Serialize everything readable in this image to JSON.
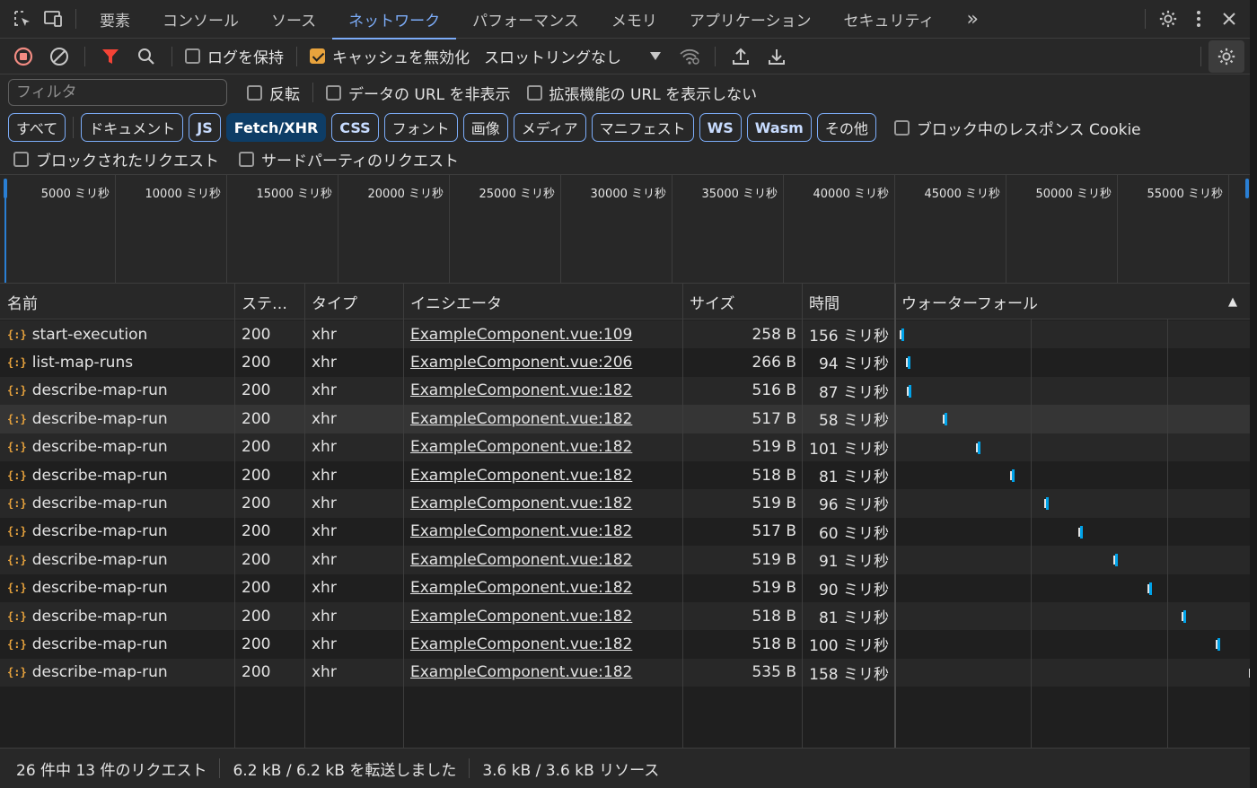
{
  "tabs": {
    "items": [
      "要素",
      "コンソール",
      "ソース",
      "ネットワーク",
      "パフォーマンス",
      "メモリ",
      "アプリケーション",
      "セキュリティ"
    ],
    "active": "ネットワーク",
    "more": "»"
  },
  "toolbar": {
    "preserve_log": "ログを保持",
    "disable_cache": "キャッシュを無効化",
    "throttling": "スロットリングなし"
  },
  "filter": {
    "placeholder": "フィルタ",
    "invert": "反転",
    "hide_data_urls": "データの URL を非表示",
    "hide_extension_urls": "拡張機能の URL を表示しない"
  },
  "type_filters": {
    "all": "すべて",
    "document": "ドキュメント",
    "js": "JS",
    "fetch_xhr": "Fetch/XHR",
    "css": "CSS",
    "font": "フォント",
    "image": "画像",
    "media": "メディア",
    "manifest": "マニフェスト",
    "ws": "WS",
    "wasm": "Wasm",
    "other": "その他",
    "blocked_cookies": "ブロック中のレスポンス Cookie"
  },
  "blocked": {
    "blocked_requests": "ブロックされたリクエスト",
    "third_party": "サードパーティのリクエスト"
  },
  "overview": {
    "labels": [
      "5000 ミリ秒",
      "10000 ミリ秒",
      "15000 ミリ秒",
      "20000 ミリ秒",
      "25000 ミリ秒",
      "30000 ミリ秒",
      "35000 ミリ秒",
      "40000 ミリ秒",
      "45000 ミリ秒",
      "50000 ミリ秒",
      "55000 ミリ秒"
    ]
  },
  "columns": {
    "name": "名前",
    "status": "ステ…",
    "type": "タイプ",
    "initiator": "イニシエータ",
    "size": "サイズ",
    "time": "時間",
    "waterfall": "ウォーターフォール",
    "sort_icon": "▲"
  },
  "rows": [
    {
      "name": "start-execution",
      "status": "200",
      "type": "xhr",
      "initiator": "ExampleComponent.vue:109",
      "size": "258 B",
      "time": "156 ミリ秒"
    },
    {
      "name": "list-map-runs",
      "status": "200",
      "type": "xhr",
      "initiator": "ExampleComponent.vue:206",
      "size": "266 B",
      "time": "94 ミリ秒"
    },
    {
      "name": "describe-map-run",
      "status": "200",
      "type": "xhr",
      "initiator": "ExampleComponent.vue:182",
      "size": "516 B",
      "time": "87 ミリ秒"
    },
    {
      "name": "describe-map-run",
      "status": "200",
      "type": "xhr",
      "initiator": "ExampleComponent.vue:182",
      "size": "517 B",
      "time": "58 ミリ秒"
    },
    {
      "name": "describe-map-run",
      "status": "200",
      "type": "xhr",
      "initiator": "ExampleComponent.vue:182",
      "size": "519 B",
      "time": "101 ミリ秒"
    },
    {
      "name": "describe-map-run",
      "status": "200",
      "type": "xhr",
      "initiator": "ExampleComponent.vue:182",
      "size": "518 B",
      "time": "81 ミリ秒"
    },
    {
      "name": "describe-map-run",
      "status": "200",
      "type": "xhr",
      "initiator": "ExampleComponent.vue:182",
      "size": "519 B",
      "time": "96 ミリ秒"
    },
    {
      "name": "describe-map-run",
      "status": "200",
      "type": "xhr",
      "initiator": "ExampleComponent.vue:182",
      "size": "517 B",
      "time": "60 ミリ秒"
    },
    {
      "name": "describe-map-run",
      "status": "200",
      "type": "xhr",
      "initiator": "ExampleComponent.vue:182",
      "size": "519 B",
      "time": "91 ミリ秒"
    },
    {
      "name": "describe-map-run",
      "status": "200",
      "type": "xhr",
      "initiator": "ExampleComponent.vue:182",
      "size": "519 B",
      "time": "90 ミリ秒"
    },
    {
      "name": "describe-map-run",
      "status": "200",
      "type": "xhr",
      "initiator": "ExampleComponent.vue:182",
      "size": "518 B",
      "time": "81 ミリ秒"
    },
    {
      "name": "describe-map-run",
      "status": "200",
      "type": "xhr",
      "initiator": "ExampleComponent.vue:182",
      "size": "518 B",
      "time": "100 ミリ秒"
    },
    {
      "name": "describe-map-run",
      "status": "200",
      "type": "xhr",
      "initiator": "ExampleComponent.vue:182",
      "size": "535 B",
      "time": "158 ミリ秒"
    }
  ],
  "status": {
    "requests": "26 件中 13 件のリクエスト",
    "transferred": "6.2 kB / 6.2 kB を転送しました",
    "resources": "3.6 kB / 3.6 kB リソース"
  },
  "colors": {
    "accent": "#7cacf8",
    "record_red": "#f28b82",
    "filter_red": "#f44336",
    "checkbox_orange": "#e8a33d",
    "waterfall_blue": "#00a2e8"
  }
}
